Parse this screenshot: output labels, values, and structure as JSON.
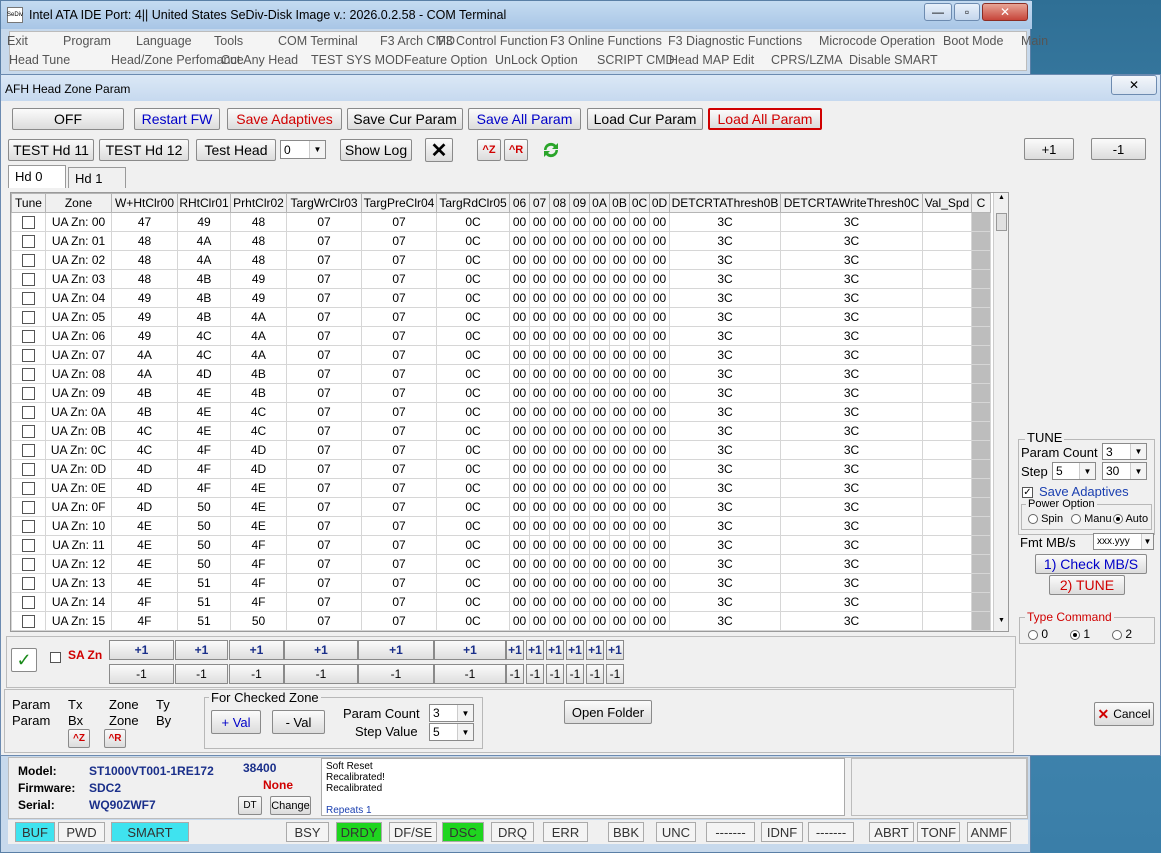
{
  "main": {
    "title": "Intel ATA IDE  Port: 4|| United States  SeDiv-Disk Image v.: 2026.0.2.58 - COM Terminal",
    "app_icon": "SeDiv",
    "menu_row1": [
      "Exit",
      "Program",
      "Language",
      "Tools",
      "COM Terminal",
      "F3 Arch CMD",
      "F3 Control Function",
      "F3 Online Functions",
      "F3 Diagnostic Functions",
      "Microcode Operation",
      "Boot Mode",
      "Main"
    ],
    "menu_row2": [
      "Head Tune",
      "Head/Zone Perfomance",
      "Cut Any Head",
      "TEST SYS MOD",
      "Feature Option",
      "UnLock Option",
      "SCRIPT CMD",
      "Head MAP Edit",
      "CPRS/LZMA",
      "Disable SMART"
    ],
    "min_label": "—",
    "max_label": "▫",
    "close_label": "✕"
  },
  "dialog": {
    "title": "AFH Head Zone Param",
    "close_label": "✕",
    "toolbar1": {
      "off": "OFF",
      "restart": "Restart FW",
      "save_adaptives": "Save Adaptives",
      "save_cur": "Save Cur Param",
      "save_all": "Save All Param",
      "load_cur": "Load Cur Param",
      "load_all": "Load All Param"
    },
    "toolbar2": {
      "test11": "TEST Hd 11",
      "test12": "TEST Hd 12",
      "test_head": "Test Head",
      "head_value": "0",
      "show_log": "Show Log",
      "ctrl_z": "^Z",
      "ctrl_r": "^R"
    },
    "plus_label": "+1",
    "minus_label": "-1",
    "tabs": [
      "Hd 0",
      "Hd 1"
    ],
    "columns": [
      "Tune",
      "Zone",
      "W+HtClr00",
      "RHtClr01",
      "PrhtClr02",
      "TargWrClr03",
      "TargPreClr04",
      "TargRdClr05",
      "06",
      "07",
      "08",
      "09",
      "0A",
      "0B",
      "0C",
      "0D",
      "DETCRTAThresh0B",
      "DETCRTAWriteThresh0C",
      "Val_Spd",
      "C"
    ],
    "rows": [
      [
        "UA Zn: 00",
        "47",
        "49",
        "48",
        "07",
        "07",
        "0C",
        "00",
        "00",
        "00",
        "00",
        "00",
        "00",
        "00",
        "00",
        "3C",
        "3C"
      ],
      [
        "UA Zn: 01",
        "48",
        "4A",
        "48",
        "07",
        "07",
        "0C",
        "00",
        "00",
        "00",
        "00",
        "00",
        "00",
        "00",
        "00",
        "3C",
        "3C"
      ],
      [
        "UA Zn: 02",
        "48",
        "4A",
        "48",
        "07",
        "07",
        "0C",
        "00",
        "00",
        "00",
        "00",
        "00",
        "00",
        "00",
        "00",
        "3C",
        "3C"
      ],
      [
        "UA Zn: 03",
        "48",
        "4B",
        "49",
        "07",
        "07",
        "0C",
        "00",
        "00",
        "00",
        "00",
        "00",
        "00",
        "00",
        "00",
        "3C",
        "3C"
      ],
      [
        "UA Zn: 04",
        "49",
        "4B",
        "49",
        "07",
        "07",
        "0C",
        "00",
        "00",
        "00",
        "00",
        "00",
        "00",
        "00",
        "00",
        "3C",
        "3C"
      ],
      [
        "UA Zn: 05",
        "49",
        "4B",
        "4A",
        "07",
        "07",
        "0C",
        "00",
        "00",
        "00",
        "00",
        "00",
        "00",
        "00",
        "00",
        "3C",
        "3C"
      ],
      [
        "UA Zn: 06",
        "49",
        "4C",
        "4A",
        "07",
        "07",
        "0C",
        "00",
        "00",
        "00",
        "00",
        "00",
        "00",
        "00",
        "00",
        "3C",
        "3C"
      ],
      [
        "UA Zn: 07",
        "4A",
        "4C",
        "4A",
        "07",
        "07",
        "0C",
        "00",
        "00",
        "00",
        "00",
        "00",
        "00",
        "00",
        "00",
        "3C",
        "3C"
      ],
      [
        "UA Zn: 08",
        "4A",
        "4D",
        "4B",
        "07",
        "07",
        "0C",
        "00",
        "00",
        "00",
        "00",
        "00",
        "00",
        "00",
        "00",
        "3C",
        "3C"
      ],
      [
        "UA Zn: 09",
        "4B",
        "4E",
        "4B",
        "07",
        "07",
        "0C",
        "00",
        "00",
        "00",
        "00",
        "00",
        "00",
        "00",
        "00",
        "3C",
        "3C"
      ],
      [
        "UA Zn: 0A",
        "4B",
        "4E",
        "4C",
        "07",
        "07",
        "0C",
        "00",
        "00",
        "00",
        "00",
        "00",
        "00",
        "00",
        "00",
        "3C",
        "3C"
      ],
      [
        "UA Zn: 0B",
        "4C",
        "4E",
        "4C",
        "07",
        "07",
        "0C",
        "00",
        "00",
        "00",
        "00",
        "00",
        "00",
        "00",
        "00",
        "3C",
        "3C"
      ],
      [
        "UA Zn: 0C",
        "4C",
        "4F",
        "4D",
        "07",
        "07",
        "0C",
        "00",
        "00",
        "00",
        "00",
        "00",
        "00",
        "00",
        "00",
        "3C",
        "3C"
      ],
      [
        "UA Zn: 0D",
        "4D",
        "4F",
        "4D",
        "07",
        "07",
        "0C",
        "00",
        "00",
        "00",
        "00",
        "00",
        "00",
        "00",
        "00",
        "3C",
        "3C"
      ],
      [
        "UA Zn: 0E",
        "4D",
        "4F",
        "4E",
        "07",
        "07",
        "0C",
        "00",
        "00",
        "00",
        "00",
        "00",
        "00",
        "00",
        "00",
        "3C",
        "3C"
      ],
      [
        "UA Zn: 0F",
        "4D",
        "50",
        "4E",
        "07",
        "07",
        "0C",
        "00",
        "00",
        "00",
        "00",
        "00",
        "00",
        "00",
        "00",
        "3C",
        "3C"
      ],
      [
        "UA Zn: 10",
        "4E",
        "50",
        "4E",
        "07",
        "07",
        "0C",
        "00",
        "00",
        "00",
        "00",
        "00",
        "00",
        "00",
        "00",
        "3C",
        "3C"
      ],
      [
        "UA Zn: 11",
        "4E",
        "50",
        "4F",
        "07",
        "07",
        "0C",
        "00",
        "00",
        "00",
        "00",
        "00",
        "00",
        "00",
        "00",
        "3C",
        "3C"
      ],
      [
        "UA Zn: 12",
        "4E",
        "50",
        "4F",
        "07",
        "07",
        "0C",
        "00",
        "00",
        "00",
        "00",
        "00",
        "00",
        "00",
        "00",
        "3C",
        "3C"
      ],
      [
        "UA Zn: 13",
        "4E",
        "51",
        "4F",
        "07",
        "07",
        "0C",
        "00",
        "00",
        "00",
        "00",
        "00",
        "00",
        "00",
        "00",
        "3C",
        "3C"
      ],
      [
        "UA Zn: 14",
        "4F",
        "51",
        "4F",
        "07",
        "07",
        "0C",
        "00",
        "00",
        "00",
        "00",
        "00",
        "00",
        "00",
        "00",
        "3C",
        "3C"
      ],
      [
        "UA Zn: 15",
        "4F",
        "51",
        "50",
        "07",
        "07",
        "0C",
        "00",
        "00",
        "00",
        "00",
        "00",
        "00",
        "00",
        "00",
        "3C",
        "3C"
      ]
    ],
    "sa_zn_label": "SA Zn",
    "bottom": {
      "param1": "Param",
      "param2": "Param",
      "tx": "Tx",
      "bx": "Bx",
      "zone1": "Zone",
      "zone2": "Zone",
      "ty": "Ty",
      "by": "By",
      "group_title": "For Checked Zone",
      "plus_val": "+ Val",
      "minus_val": "- Val",
      "param_count_label": "Param Count",
      "param_count": "3",
      "step_value_label": "Step Value",
      "step_value": "5",
      "open_folder": "Open Folder",
      "cancel": "Cancel"
    },
    "tune": {
      "title": "TUNE",
      "param_count_label": "Param Count",
      "param_count": "3",
      "step_label": "Step",
      "step": "5",
      "step2": "30",
      "save_adaptives": "Save Adaptives",
      "power_option": "Power Option",
      "spin": "Spin",
      "manu": "Manu",
      "auto": "Auto",
      "fmt_label": "Fmt MB/s",
      "fmt_value": "xxx.yyy",
      "check_mbs": "1) Check MB/S",
      "tune_btn": "2) TUNE",
      "type_command": "Type Command",
      "t0": "0",
      "t1": "1",
      "t2": "2"
    }
  },
  "drive": {
    "model_label": "Model:",
    "model": "ST1000VT001-1RE172",
    "baud": "38400",
    "firmware_label": "Firmware:",
    "firmware": "SDC2",
    "none": "None",
    "serial_label": "Serial:",
    "serial": "WQ90ZWF7",
    "dt": "DT",
    "change": "Change",
    "log": [
      "Soft Reset",
      "Recalibrated!",
      "Recalibrated",
      "",
      "Repeats 1"
    ]
  },
  "status": [
    "BUF",
    "PWD",
    "SMART",
    "BSY",
    "DRDY",
    "DF/SE",
    "DSC",
    "DRQ",
    "ERR",
    "BBK",
    "UNC",
    "-------",
    "IDNF",
    "-------",
    "ABRT",
    "TONF",
    "ANMF"
  ]
}
